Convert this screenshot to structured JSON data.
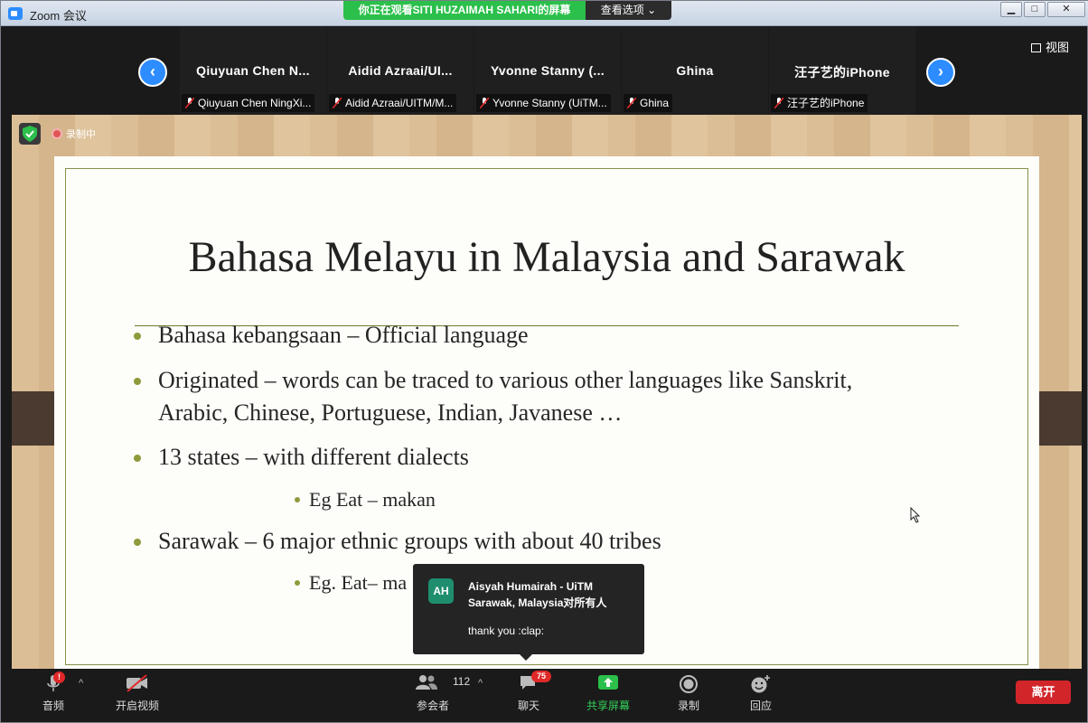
{
  "window": {
    "title": "Zoom 会议"
  },
  "banner": {
    "viewing": "你正在观看SITI  HUZAIMAH SAHARI的屏幕",
    "view_options": "查看选项"
  },
  "strip": {
    "view_label": "视图",
    "participants": [
      {
        "name": "Qiuyuan  Chen  N...",
        "tag": "Qiuyuan Chen NingXi..."
      },
      {
        "name": "Aidid  Azraai/UI...",
        "tag": "Aidid Azraai/UITM/M..."
      },
      {
        "name": "Yvonne  Stanny  (...",
        "tag": "Yvonne Stanny (UiTM..."
      },
      {
        "name": "Ghina",
        "tag": "Ghina"
      },
      {
        "name": "汪子艺的iPhone",
        "tag": "汪子艺的iPhone"
      }
    ]
  },
  "status": {
    "recording": "录制中"
  },
  "slide": {
    "title": "Bahasa Melayu in Malaysia and Sarawak",
    "bullets": [
      {
        "text": "Bahasa kebangsaan – Official language"
      },
      {
        "line1": "Originated – words can be traced to various other languages like Sanskrit,",
        "line2": "Arabic, Chinese, Portuguese, Indian, Javanese …"
      },
      {
        "text": "13 states – with different dialects"
      },
      {
        "text": "Eg Eat – makan"
      },
      {
        "text": "Sarawak – 6 major ethnic groups with about 40 tribes"
      },
      {
        "text": "Eg. Eat– ma"
      }
    ]
  },
  "chat_popup": {
    "avatar": "AH",
    "sender": "Aisyah Humairah - UiTM Sarawak, Malaysia对所有人",
    "message": "thank you :clap:"
  },
  "toolbar": {
    "audio": "音频",
    "audio_badge": "!",
    "video": "开启视频",
    "participants": "参会者",
    "participants_count": "112",
    "chat": "聊天",
    "chat_badge": "75",
    "share": "共享屏幕",
    "record": "录制",
    "reactions": "回应",
    "leave": "离开"
  },
  "colors": {
    "banner": "#2bbf4b",
    "accent": "#2d8cff",
    "leave": "#d2252a",
    "share": "#34d058",
    "bullet": "#8f9a3d"
  }
}
